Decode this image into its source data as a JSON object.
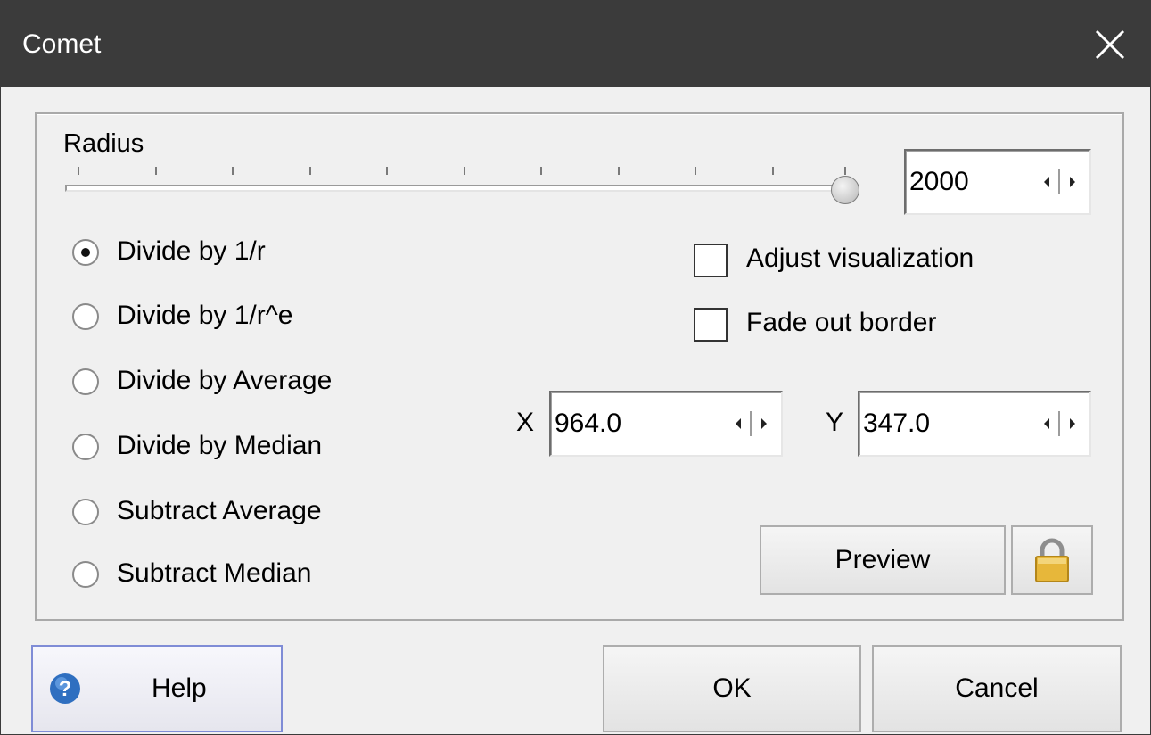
{
  "window": {
    "title": "Comet"
  },
  "radius": {
    "label": "Radius",
    "value": "2000",
    "slider_fraction": 1.0
  },
  "modes": [
    {
      "label": "Divide by 1/r",
      "selected": true
    },
    {
      "label": "Divide by 1/r^e",
      "selected": false
    },
    {
      "label": "Divide by Average",
      "selected": false
    },
    {
      "label": "Divide by Median",
      "selected": false
    },
    {
      "label": "Subtract Average",
      "selected": false
    },
    {
      "label": "Subtract Median",
      "selected": false
    }
  ],
  "options": {
    "adjust_visualization": {
      "label": "Adjust visualization",
      "checked": false
    },
    "fade_out_border": {
      "label": "Fade out border",
      "checked": false
    }
  },
  "position": {
    "x_label": "X",
    "x_value": "964.0",
    "y_label": "Y",
    "y_value": "347.0"
  },
  "buttons": {
    "preview": "Preview",
    "help": "Help",
    "ok": "OK",
    "cancel": "Cancel"
  },
  "icons": {
    "close": "close-icon",
    "lock": "lock-icon",
    "help": "help-icon",
    "spin_left": "arrow-left-icon",
    "spin_right": "arrow-right-icon"
  },
  "colors": {
    "titlebar": "#3b3b3b",
    "window_bg": "#f0f0f0",
    "help_border": "#7f8cd6"
  }
}
